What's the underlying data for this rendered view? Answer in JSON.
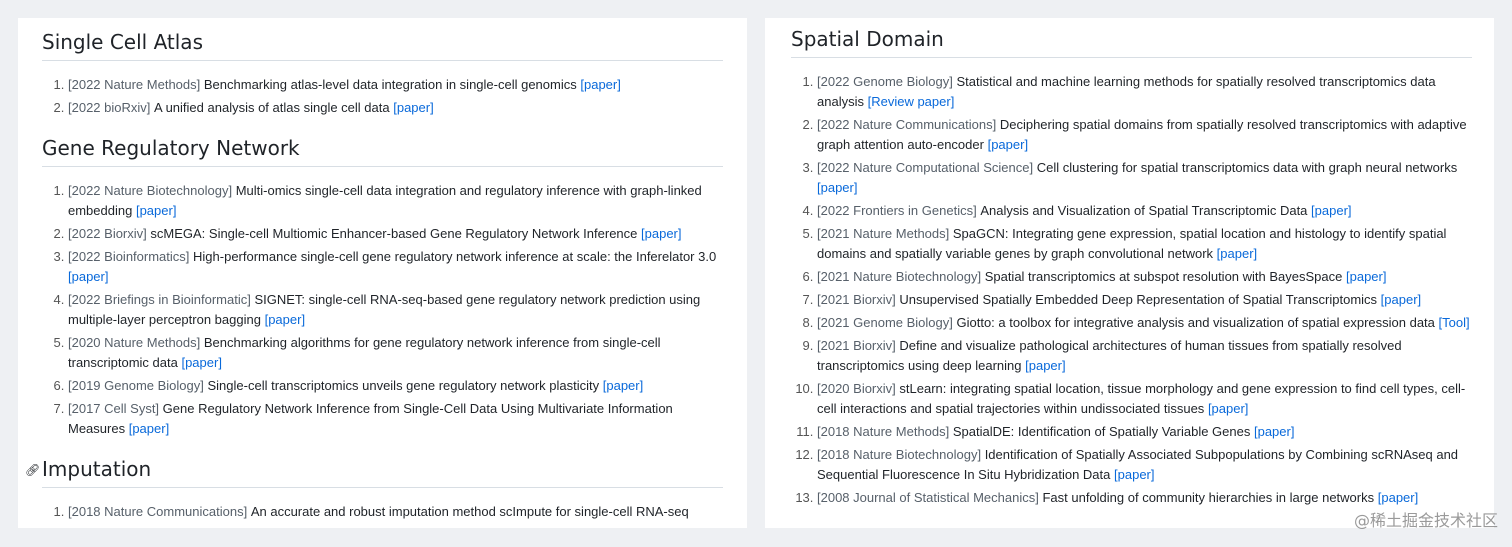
{
  "left": {
    "sections": [
      {
        "title": "Single Cell Atlas",
        "items": [
          {
            "venue": "[2022 Nature Methods]",
            "title": "Benchmarking atlas-level data integration in single-cell genomics",
            "link": "[paper]"
          },
          {
            "venue": "[2022 bioRxiv]",
            "title": "A unified analysis of atlas single cell data",
            "link": "[paper]"
          }
        ]
      },
      {
        "title": "Gene Regulatory Network",
        "items": [
          {
            "venue": "[2022 Nature Biotechnology]",
            "title": "Multi-omics single-cell data integration and regulatory inference with graph-linked embedding",
            "link": "[paper]"
          },
          {
            "venue": "[2022 Biorxiv]",
            "title": "scMEGA: Single-cell Multiomic Enhancer-based Gene Regulatory Network Inference",
            "link": "[paper]"
          },
          {
            "venue": "[2022 Bioinformatics]",
            "title": "High-performance single-cell gene regulatory network inference at scale: the Inferelator 3.0",
            "link": "[paper]"
          },
          {
            "venue": "[2022 Briefings in Bioinformatic]",
            "title": "SIGNET: single-cell RNA-seq-based gene regulatory network prediction using multiple-layer perceptron bagging",
            "link": "[paper]"
          },
          {
            "venue": "[2020 Nature Methods]",
            "title": "Benchmarking algorithms for gene regulatory network inference from single-cell transcriptomic data",
            "link": "[paper]"
          },
          {
            "venue": "[2019 Genome Biology]",
            "title": "Single-cell transcriptomics unveils gene regulatory network plasticity",
            "link": "[paper]"
          },
          {
            "venue": "[2017 Cell Syst]",
            "title": "Gene Regulatory Network Inference from Single-Cell Data Using Multivariate Information Measures",
            "link": "[paper]"
          }
        ]
      },
      {
        "title": "Imputation",
        "anchor_icon": "link-icon",
        "items": [
          {
            "venue": "[2018 Nature Communications]",
            "title": "An accurate and robust imputation method scImpute for single-cell RNA-seq",
            "link": ""
          }
        ]
      }
    ]
  },
  "right": {
    "sections": [
      {
        "title": "Spatial Domain",
        "items": [
          {
            "venue": "[2022 Genome Biology]",
            "title": "Statistical and machine learning methods for spatially resolved transcriptomics data analysis",
            "link": "[Review paper]"
          },
          {
            "venue": "[2022 Nature Communications]",
            "title": "Deciphering spatial domains from spatially resolved transcriptomics with adaptive graph attention auto-encoder",
            "link": "[paper]"
          },
          {
            "venue": "[2022 Nature Computational Science]",
            "title": "Cell clustering for spatial transcriptomics data with graph neural networks",
            "link": "[paper]"
          },
          {
            "venue": "[2022 Frontiers in Genetics]",
            "title": "Analysis and Visualization of Spatial Transcriptomic Data",
            "link": "[paper]"
          },
          {
            "venue": "[2021 Nature Methods]",
            "title": "SpaGCN: Integrating gene expression, spatial location and histology to identify spatial domains and spatially variable genes by graph convolutional network",
            "link": "[paper]"
          },
          {
            "venue": "[2021 Nature Biotechnology]",
            "title": "Spatial transcriptomics at subspot resolution with BayesSpace",
            "link": "[paper]"
          },
          {
            "venue": "[2021 Biorxiv]",
            "title": "Unsupervised Spatially Embedded Deep Representation of Spatial Transcriptomics",
            "link": "[paper]"
          },
          {
            "venue": "[2021 Genome Biology]",
            "title": "Giotto: a toolbox for integrative analysis and visualization of spatial expression data",
            "link": "[Tool]"
          },
          {
            "venue": "[2021 Biorxiv]",
            "title": "Define and visualize pathological architectures of human tissues from spatially resolved transcriptomics using deep learning",
            "link": "[paper]"
          },
          {
            "venue": "[2020 Biorxiv]",
            "title": "stLearn: integrating spatial location, tissue morphology and gene expression to find cell types, cell-cell interactions and spatial trajectories within undissociated tissues",
            "link": "[paper]"
          },
          {
            "venue": "[2018 Nature Methods]",
            "title": "SpatialDE: Identification of Spatially Variable Genes",
            "link": "[paper]"
          },
          {
            "venue": "[2018 Nature Biotechnology]",
            "title": "Identification of Spatially Associated Subpopulations by Combining scRNAseq and Sequential Fluorescence In Situ Hybridization Data",
            "link": "[paper]"
          },
          {
            "venue": "[2008 Journal of Statistical Mechanics]",
            "title": "Fast unfolding of community hierarchies in large networks",
            "link": "[paper]"
          }
        ]
      }
    ]
  },
  "watermark": "@稀土掘金技术社区",
  "colors": {
    "link": "#0969da",
    "venue": "#57606a",
    "text": "#1f2328",
    "rule": "#d8dee4"
  }
}
